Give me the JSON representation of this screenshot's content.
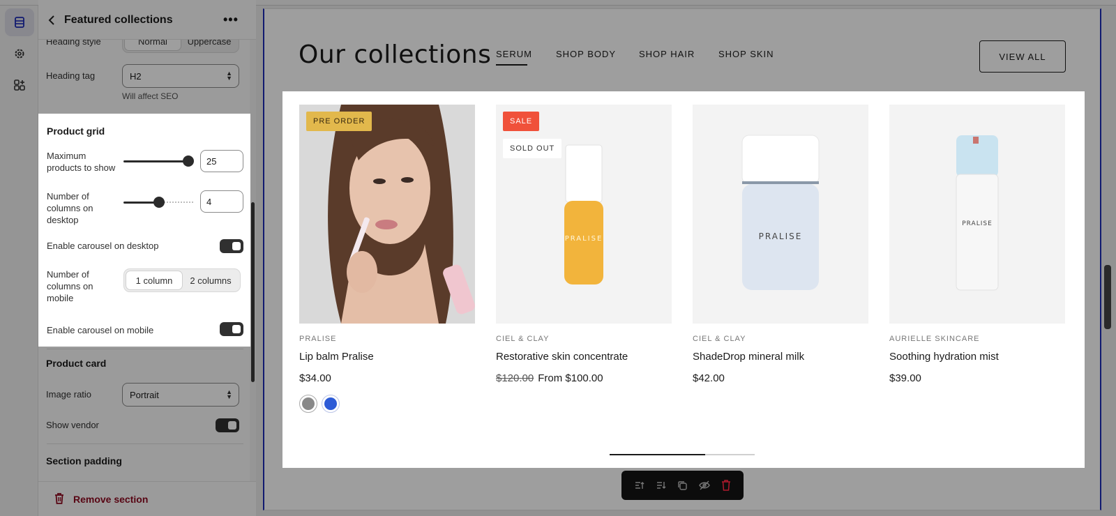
{
  "panel": {
    "title": "Featured collections",
    "heading_style": {
      "label": "Heading style",
      "options": [
        "Normal",
        "Uppercase"
      ],
      "selected": "Uppercase"
    },
    "heading_tag": {
      "label": "Heading tag",
      "value": "H2",
      "hint": "Will affect SEO"
    },
    "product_grid": {
      "title": "Product grid",
      "max_products": {
        "label": "Maximum products to show",
        "value": "25"
      },
      "columns_desktop": {
        "label": "Number of columns on desktop",
        "value": "4"
      },
      "carousel_desktop": {
        "label": "Enable carousel on desktop",
        "on": true
      },
      "columns_mobile": {
        "label": "Number of columns on mobile",
        "options": [
          "1 column",
          "2 columns"
        ],
        "selected": "1 column"
      },
      "carousel_mobile": {
        "label": "Enable carousel on mobile",
        "on": true
      }
    },
    "product_card": {
      "title": "Product card",
      "image_ratio": {
        "label": "Image ratio",
        "value": "Portrait"
      },
      "show_vendor": {
        "label": "Show vendor",
        "on": true
      }
    },
    "section_padding": {
      "title": "Section padding"
    },
    "remove_label": "Remove section"
  },
  "preview": {
    "title": "Our collections",
    "tabs": [
      "SERUM",
      "SHOP BODY",
      "SHOP HAIR",
      "SHOP SKIN"
    ],
    "active_tab": "SERUM",
    "view_all": "VIEW ALL",
    "products": [
      {
        "badge": "PRE ORDER",
        "vendor": "PRALISE",
        "name": "Lip balm Pralise",
        "price": "$34.00",
        "swatches": [
          "#888888",
          "#2d5bd6"
        ]
      },
      {
        "badge": "SALE",
        "badge2": "SOLD OUT",
        "vendor": "CIEL & CLAY",
        "name": "Restorative skin concentrate",
        "compare_price": "$120.00",
        "price": "From $100.00",
        "bottle_label": "PRALISE"
      },
      {
        "vendor": "CIEL & CLAY",
        "name": "ShadeDrop mineral milk",
        "price": "$42.00",
        "bottle_label": "PRALISE"
      },
      {
        "vendor": "AURIELLE SKINCARE",
        "name": "Soothing hydration mist",
        "price": "$39.00",
        "bottle_label": "PRALISE"
      }
    ],
    "carousel_progress": 0.66
  },
  "colors": {
    "accent": "#1c2bb5",
    "badge_preorder": "#e2b84c",
    "badge_sale": "#f0513a",
    "danger": "#8e0b21"
  },
  "icons": {
    "rail": [
      "sections-icon",
      "settings-gear-icon",
      "apps-icon"
    ],
    "toolbar": [
      "move-up-icon",
      "move-down-icon",
      "duplicate-icon",
      "hide-icon",
      "delete-icon"
    ]
  }
}
